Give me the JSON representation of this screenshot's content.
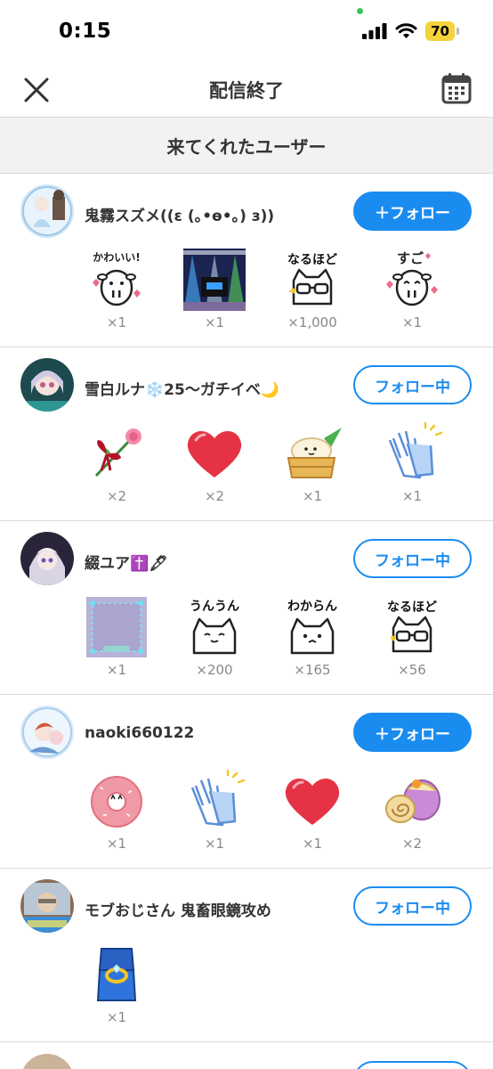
{
  "status_bar": {
    "time": "0:15",
    "battery": "70"
  },
  "header": {
    "title": "配信終了",
    "close_icon": "close-icon",
    "calendar_icon": "calendar-icon"
  },
  "section": {
    "title": "来てくれたユーザー"
  },
  "users": [
    {
      "name": "鬼霧スズメ((ε (｡•ө•｡) з))",
      "follow_label": "＋フォロー",
      "following": false,
      "gifts": [
        {
          "label": "かわいい!",
          "icon": "cow-sticker-icon",
          "count": "×1"
        },
        {
          "label": "",
          "icon": "stage-lights-icon",
          "count": "×1"
        },
        {
          "label": "なるほど",
          "icon": "cat-glasses-icon",
          "count": "×1,000"
        },
        {
          "label": "すご",
          "icon": "cow-sticker-icon",
          "count": "×1"
        }
      ]
    },
    {
      "name": "雪白ルナ❄️25〜ガチイベ🌙",
      "follow_label": "フォロー中",
      "following": true,
      "gifts": [
        {
          "label": "",
          "icon": "rose-icon",
          "count": "×2"
        },
        {
          "label": "",
          "icon": "heart-icon",
          "count": "×2"
        },
        {
          "label": "",
          "icon": "dumpling-icon",
          "count": "×1"
        },
        {
          "label": "",
          "icon": "clapping-hands-icon",
          "count": "×1"
        }
      ]
    },
    {
      "name": "綴ユア✝️🖋",
      "follow_label": "フォロー中",
      "following": true,
      "gifts": [
        {
          "label": "",
          "icon": "frame-icon",
          "count": "×1"
        },
        {
          "label": "うんうん",
          "icon": "cat-sticker-icon",
          "count": "×200"
        },
        {
          "label": "わからん",
          "icon": "cat-sticker-icon",
          "count": "×165"
        },
        {
          "label": "なるほど",
          "icon": "cat-glasses-icon",
          "count": "×56"
        }
      ]
    },
    {
      "name": "naoki660122",
      "follow_label": "＋フォロー",
      "following": false,
      "gifts": [
        {
          "label": "",
          "icon": "donut-icon",
          "count": "×1"
        },
        {
          "label": "",
          "icon": "clapping-hands-icon",
          "count": "×1"
        },
        {
          "label": "",
          "icon": "heart-icon",
          "count": "×1"
        },
        {
          "label": "",
          "icon": "roll-cake-icon",
          "count": "×2"
        }
      ]
    },
    {
      "name": "モブおじさん 鬼畜眼鏡攻め",
      "follow_label": "フォロー中",
      "following": true,
      "gifts": [
        {
          "label": "",
          "icon": "ring-box-icon",
          "count": "×1"
        }
      ]
    }
  ],
  "colors": {
    "accent": "#1a8cf0",
    "divider": "#dadada",
    "section_bg": "#f2f2f4"
  }
}
